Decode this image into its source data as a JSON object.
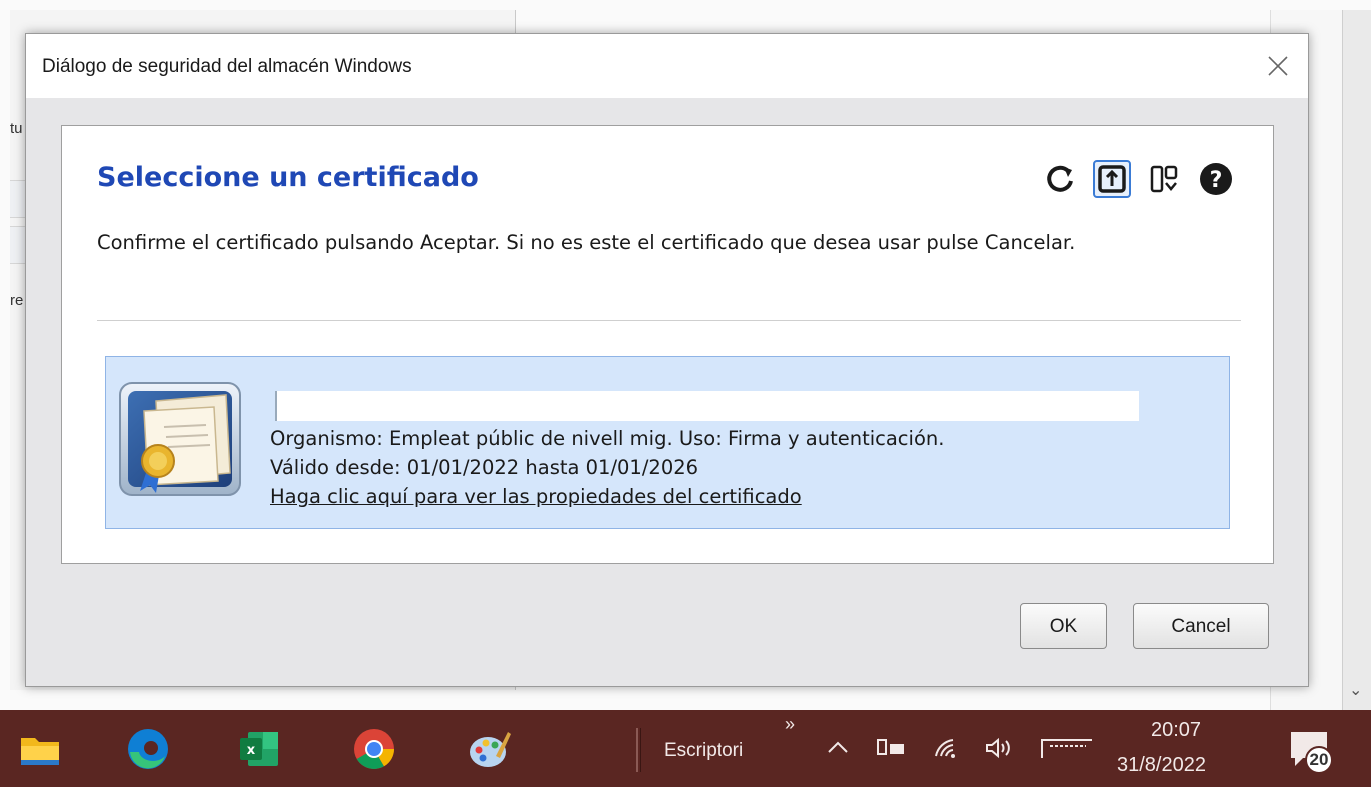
{
  "background": {
    "left_fragment_1": "tu",
    "left_fragment_2": "re"
  },
  "dialog": {
    "title": "Diálogo de seguridad del almacén Windows",
    "heading": "Seleccione un certificado",
    "description": "Confirme el certificado pulsando Aceptar. Si no es este el certificado que desea usar pulse Cancelar.",
    "toolbar": [
      {
        "icon": "refresh-icon"
      },
      {
        "icon": "import-icon"
      },
      {
        "icon": "view-icon"
      },
      {
        "icon": "help-icon"
      }
    ],
    "certificate": {
      "name": "",
      "organization_line": "Organismo: Empleat públic de nivell mig. Uso: Firma y autenticación.",
      "validity_line": "Válido desde: 01/01/2022 hasta 01/01/2026",
      "properties_link": "Haga clic aquí para ver las propiedades del certificado"
    },
    "ok_label": "OK",
    "cancel_label": "Cancel"
  },
  "taskbar": {
    "apps": [
      "file-explorer-icon",
      "edge-icon",
      "excel-icon",
      "chrome-icon",
      "paint-icon"
    ],
    "desktop_label": "Escriptori",
    "overflow_label": "»",
    "time": "20:07",
    "date": "31/8/2022",
    "notification_count": "20"
  },
  "colors": {
    "heading": "#1f48b5",
    "selection": "#d5e6fb",
    "taskbar": "#5a2622"
  }
}
